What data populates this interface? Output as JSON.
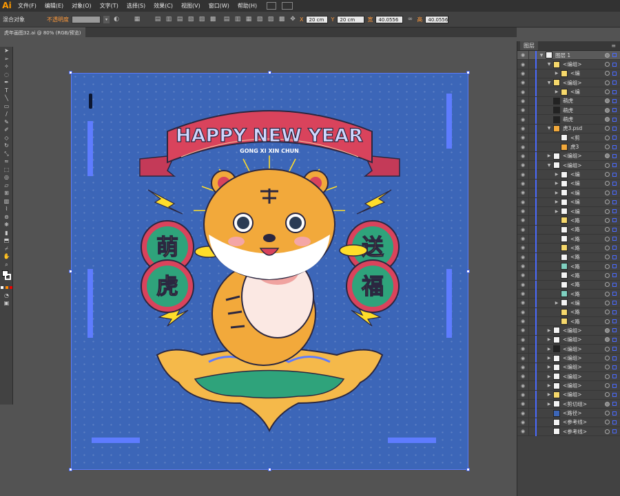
{
  "app": {
    "logo": "Ai"
  },
  "menu": [
    "文件(F)",
    "编辑(E)",
    "对象(O)",
    "文字(T)",
    "选择(S)",
    "效果(C)",
    "视图(V)",
    "窗口(W)",
    "帮助(H)"
  ],
  "control": {
    "mixed_objects": "混合对象",
    "opacity_label": "不透明度",
    "x_label": "X",
    "x_value": "20 cm",
    "y_label": "Y",
    "y_value": "20 cm",
    "w_label": "宽",
    "w_value": "40.0556",
    "h_label": "高",
    "h_value": "40.0556"
  },
  "document": {
    "tab_title": "虎年画图32.ai @ 80% (RGB/预览)"
  },
  "artwork": {
    "banner_title": "HAPPY NEW YEAR",
    "banner_sub": "GONG XI XIN CHUN",
    "left_chars": [
      "萌",
      "虎"
    ],
    "right_chars": [
      "送",
      "福"
    ],
    "colors": {
      "background": "#3c66b8",
      "banner": "#d9435c",
      "badge_ring": "#d9435c",
      "badge_inner": "#2fa37b",
      "tiger": "#f2a93b",
      "yellow": "#ffdd2a"
    }
  },
  "layers_panel": {
    "title": "图层",
    "rows": [
      {
        "indent": 0,
        "expand": "down",
        "thumb": "layer",
        "name": "图层 1",
        "filled": true,
        "selected": true
      },
      {
        "indent": 1,
        "expand": "down",
        "thumb": "yellow",
        "name": "<编组>",
        "filled": false
      },
      {
        "indent": 2,
        "expand": "right",
        "thumb": "yellow",
        "name": "<编",
        "filled": false
      },
      {
        "indent": 1,
        "expand": "down",
        "thumb": "yellow",
        "name": "<编组>",
        "filled": false
      },
      {
        "indent": 2,
        "expand": "right",
        "thumb": "yellow",
        "name": "<编",
        "filled": false
      },
      {
        "indent": 1,
        "expand": "",
        "thumb": "dark",
        "name": "萌虎",
        "filled": true
      },
      {
        "indent": 1,
        "expand": "",
        "thumb": "dark",
        "name": "萌虎",
        "filled": true
      },
      {
        "indent": 1,
        "expand": "",
        "thumb": "dark",
        "name": "萌虎",
        "filled": true
      },
      {
        "indent": 1,
        "expand": "down",
        "thumb": "tiger",
        "name": "虎3.psd",
        "filled": false
      },
      {
        "indent": 2,
        "expand": "",
        "thumb": "white",
        "name": "<剪",
        "filled": false
      },
      {
        "indent": 2,
        "expand": "",
        "thumb": "tiger",
        "name": "虎3",
        "filled": false
      },
      {
        "indent": 1,
        "expand": "right",
        "thumb": "white",
        "name": "<编组>",
        "filled": true
      },
      {
        "indent": 1,
        "expand": "down",
        "thumb": "white",
        "name": "<编组>",
        "filled": false
      },
      {
        "indent": 2,
        "expand": "right",
        "thumb": "white",
        "name": "<编",
        "filled": false
      },
      {
        "indent": 2,
        "expand": "right",
        "thumb": "white",
        "name": "<编",
        "filled": false
      },
      {
        "indent": 2,
        "expand": "right",
        "thumb": "white",
        "name": "<编",
        "filled": false
      },
      {
        "indent": 2,
        "expand": "right",
        "thumb": "white",
        "name": "<编",
        "filled": false
      },
      {
        "indent": 2,
        "expand": "right",
        "thumb": "white",
        "name": "<编",
        "filled": false
      },
      {
        "indent": 2,
        "expand": "",
        "thumb": "yellow",
        "name": "<路",
        "filled": false
      },
      {
        "indent": 2,
        "expand": "",
        "thumb": "white",
        "name": "<路",
        "filled": false
      },
      {
        "indent": 2,
        "expand": "",
        "thumb": "white",
        "name": "<路",
        "filled": false
      },
      {
        "indent": 2,
        "expand": "",
        "thumb": "yellow",
        "name": "<路",
        "filled": false
      },
      {
        "indent": 2,
        "expand": "",
        "thumb": "white",
        "name": "<路",
        "filled": false
      },
      {
        "indent": 2,
        "expand": "",
        "thumb": "teal",
        "name": "<路",
        "filled": false
      },
      {
        "indent": 2,
        "expand": "",
        "thumb": "white",
        "name": "<路",
        "filled": false
      },
      {
        "indent": 2,
        "expand": "",
        "thumb": "white",
        "name": "<路",
        "filled": false
      },
      {
        "indent": 2,
        "expand": "",
        "thumb": "teal",
        "name": "<路",
        "filled": false
      },
      {
        "indent": 2,
        "expand": "right",
        "thumb": "white",
        "name": "<编",
        "filled": false
      },
      {
        "indent": 2,
        "expand": "",
        "thumb": "yellow",
        "name": "<路",
        "filled": false
      },
      {
        "indent": 2,
        "expand": "",
        "thumb": "yellow",
        "name": "<路",
        "filled": false
      },
      {
        "indent": 1,
        "expand": "right",
        "thumb": "white",
        "name": "<编组>",
        "filled": true
      },
      {
        "indent": 1,
        "expand": "right",
        "thumb": "white",
        "name": "<编组>",
        "filled": true
      },
      {
        "indent": 1,
        "expand": "right",
        "thumb": "dark",
        "name": "<编组>",
        "filled": false
      },
      {
        "indent": 1,
        "expand": "right",
        "thumb": "white",
        "name": "<编组>",
        "filled": false
      },
      {
        "indent": 1,
        "expand": "right",
        "thumb": "white",
        "name": "<编组>",
        "filled": false
      },
      {
        "indent": 1,
        "expand": "right",
        "thumb": "white",
        "name": "<编组>",
        "filled": false
      },
      {
        "indent": 1,
        "expand": "right",
        "thumb": "white",
        "name": "<编组>",
        "filled": false
      },
      {
        "indent": 1,
        "expand": "right",
        "thumb": "yellow",
        "name": "<编组>",
        "filled": false
      },
      {
        "indent": 1,
        "expand": "right",
        "thumb": "white",
        "name": "<剪切组>",
        "filled": true
      },
      {
        "indent": 1,
        "expand": "",
        "thumb": "blue",
        "name": "<路径>",
        "filled": false
      },
      {
        "indent": 1,
        "expand": "",
        "thumb": "white",
        "name": "<参考线>",
        "filled": false
      },
      {
        "indent": 1,
        "expand": "",
        "thumb": "white",
        "name": "<参考线>",
        "filled": false
      }
    ]
  }
}
